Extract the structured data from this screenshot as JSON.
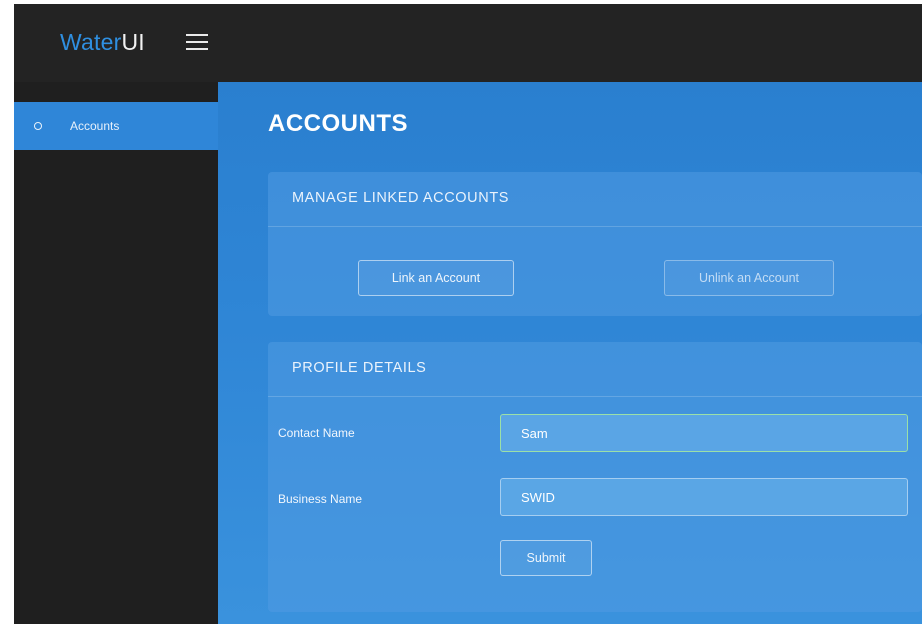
{
  "brand": {
    "part1": "Water",
    "part2": "UI"
  },
  "sidebar": {
    "items": [
      {
        "label": "Accounts",
        "active": true
      }
    ]
  },
  "main": {
    "title": "ACCOUNTS",
    "linked_accounts": {
      "title": "MANAGE LINKED ACCOUNTS",
      "link_label": "Link an Account",
      "unlink_label": "Unlink an Account"
    },
    "profile": {
      "title": "PROFILE DETAILS",
      "contact_label": "Contact Name",
      "contact_value": "Sam",
      "business_label": "Business Name",
      "business_value": "SWID",
      "submit_label": "Submit"
    }
  },
  "colors": {
    "accent": "#2f86d8",
    "brand_blue": "#2f8fe0",
    "topbar": "#232323",
    "sidebar": "#1f1f1f"
  },
  "icons": {
    "menu": "hamburger-menu-icon",
    "bullet": "circle-bullet-icon"
  }
}
